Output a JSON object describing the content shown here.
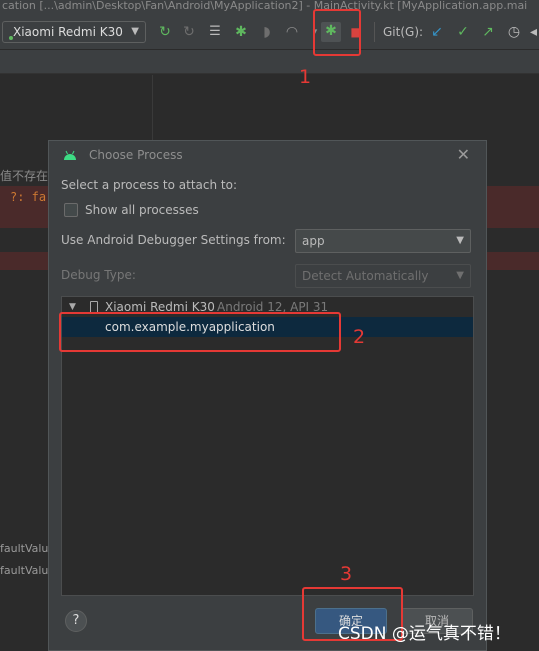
{
  "window": {
    "title": "cation [...\\admin\\Desktop\\Fan\\Android\\MyApplication2] - MainActivity.kt [MyApplication.app.mai"
  },
  "toolbar": {
    "device": "Xiaomi Redmi K30",
    "git_label": "Git(G):",
    "icons": [
      "rerun-icon",
      "restart-icon",
      "logcat-icon",
      "debug-icon",
      "coverage-icon",
      "profile-icon",
      "attach-debugger-icon",
      "stop-icon",
      "git-update-icon",
      "git-commit-icon",
      "git-push-icon",
      "history-icon"
    ]
  },
  "editor": {
    "line1": "值不存在",
    "line2": "?: fa",
    "line3": "faultValu",
    "line4": "faultValu"
  },
  "dialog": {
    "title": "Choose Process",
    "prompt": "Select a process to attach to:",
    "show_all_label": "Show all processes",
    "show_all_checked": false,
    "settings_label": "Use Android Debugger Settings from:",
    "settings_value": "app",
    "debug_type_label": "Debug Type:",
    "debug_type_value": "Detect Automatically",
    "tree": {
      "device_name": "Xiaomi Redmi K30",
      "device_detail": "Android 12, API 31",
      "process": "com.example.myapplication"
    },
    "help_label": "?",
    "ok_label": "确定",
    "cancel_label": "取消"
  },
  "annotations": {
    "n1": "1",
    "n2": "2",
    "n3": "3",
    "color": "#e53935"
  },
  "watermark": "CSDN @运气真不错！"
}
